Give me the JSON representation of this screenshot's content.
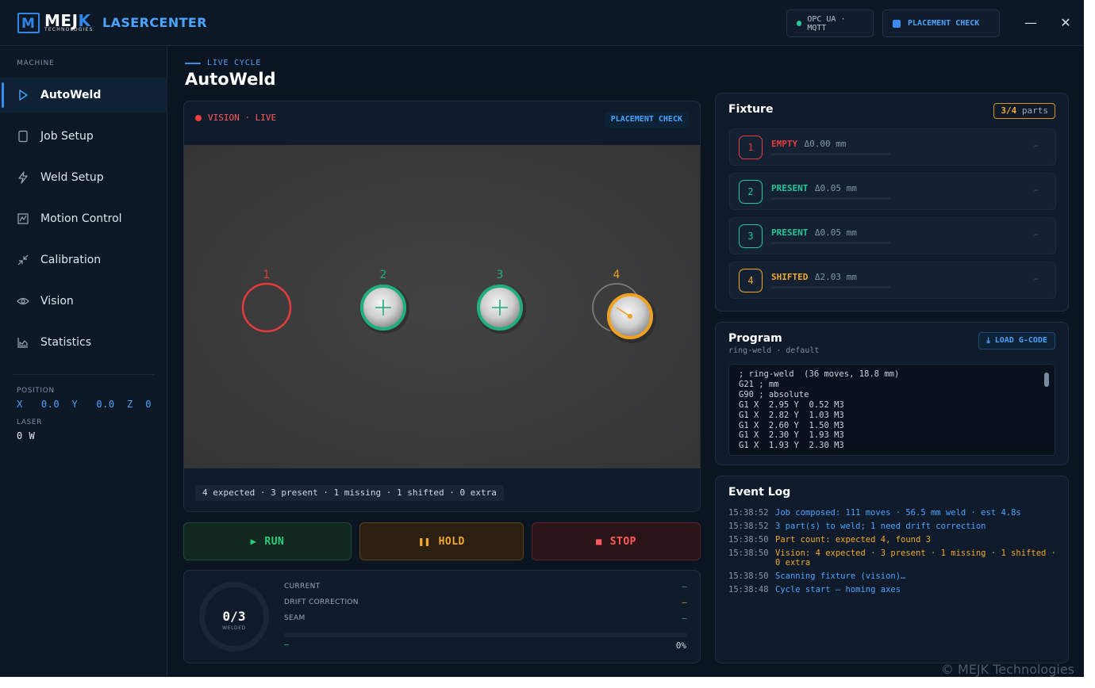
{
  "brand": {
    "mark": "M",
    "name_left": "MEJ",
    "name_right": "K",
    "sub": "TECHNOLOGIES",
    "app_title": "LASERCENTER"
  },
  "header": {
    "opc_label": "OPC UA · MQTT",
    "placement_label": "PLACEMENT CHECK",
    "minimize": "—",
    "close": "✕"
  },
  "sidebar": {
    "group": "MACHINE",
    "items": [
      {
        "label": "AutoWeld",
        "icon": "play-icon",
        "active": true
      },
      {
        "label": "Job Setup",
        "icon": "document-icon"
      },
      {
        "label": "Weld Setup",
        "icon": "lightning-icon"
      },
      {
        "label": "Motion Control",
        "icon": "chart-box-icon"
      },
      {
        "label": "Calibration",
        "icon": "crosshair-arrows-icon"
      },
      {
        "label": "Vision",
        "icon": "eye-icon"
      },
      {
        "label": "Statistics",
        "icon": "stats-icon"
      }
    ],
    "position_label": "POSITION",
    "position_value": "X   0.0  Y   0.0  Z  0",
    "laser_label": "LASER",
    "laser_value": "0 W"
  },
  "main": {
    "live_tag": "LIVE CYCLE",
    "title": "AutoWeld"
  },
  "vision": {
    "live_label": "VISION · LIVE",
    "badge": "PLACEMENT CHECK",
    "summary": "4 expected · 3 present · 1 missing · 1 shifted · 0 extra",
    "slots": [
      {
        "num": "1",
        "state": "empty",
        "color": "#e63b3b"
      },
      {
        "num": "2",
        "state": "present",
        "color": "#1fae7d"
      },
      {
        "num": "3",
        "state": "present",
        "color": "#1fae7d"
      },
      {
        "num": "4",
        "state": "shifted",
        "color": "#f0a020"
      }
    ]
  },
  "controls": {
    "run": "RUN",
    "hold": "HOLD",
    "stop": "STOP",
    "run_glyph": "▶",
    "hold_glyph": "❚❚",
    "stop_glyph": "■"
  },
  "progress": {
    "count": "0/3",
    "count_label": "WELDED",
    "rows": [
      {
        "label": "CURRENT",
        "value": "—",
        "color": "#4aa3ff"
      },
      {
        "label": "DRIFT CORRECTION",
        "value": "—",
        "color": "#f0a92a"
      },
      {
        "label": "SEAM",
        "value": "—",
        "color": "#4aa3ff"
      }
    ],
    "fraction": 0,
    "left_text": "—",
    "percent_text": "0%"
  },
  "fixture": {
    "title": "Fixture",
    "count": "3/4",
    "count_suffix": " parts",
    "rows": [
      {
        "num": "1",
        "status": "EMPTY",
        "delta": "Δ0.00 mm",
        "color": "#e63b3b",
        "dash": "–"
      },
      {
        "num": "2",
        "status": "PRESENT",
        "delta": "Δ0.05 mm",
        "color": "#20c997",
        "dash": "–"
      },
      {
        "num": "3",
        "status": "PRESENT",
        "delta": "Δ0.05 mm",
        "color": "#20c997",
        "dash": "–"
      },
      {
        "num": "4",
        "status": "SHIFTED",
        "delta": "Δ2.03 mm",
        "color": "#f0a92a",
        "dash": "–"
      }
    ]
  },
  "program": {
    "title": "Program",
    "subtitle": "ring-weld · default",
    "load_label": "⤓ LOAD G-CODE",
    "code": [
      "; ring-weld  (36 moves, 18.8 mm)",
      "G21 ; mm",
      "G90 ; absolute",
      "G1 X  2.95 Y  0.52 M3",
      "G1 X  2.82 Y  1.03 M3",
      "G1 X  2.60 Y  1.50 M3",
      "G1 X  2.30 Y  1.93 M3",
      "G1 X  1.93 Y  2.30 M3"
    ]
  },
  "log": {
    "title": "Event Log",
    "entries": [
      {
        "time": "15:38:52",
        "msg": "Job composed: 111 moves · 56.5 mm weld · est 4.8s",
        "level": "info"
      },
      {
        "time": "15:38:52",
        "msg": "3 part(s) to weld; 1 need drift correction",
        "level": "info"
      },
      {
        "time": "15:38:50",
        "msg": "Part count: expected 4, found 3",
        "level": "warn"
      },
      {
        "time": "15:38:50",
        "msg": "Vision: 4 expected · 3 present · 1 missing · 1 shifted · 0 extra",
        "level": "warn"
      },
      {
        "time": "15:38:50",
        "msg": "Scanning fixture (vision)…",
        "level": "info"
      },
      {
        "time": "15:38:48",
        "msg": "Cycle start — homing axes",
        "level": "info"
      }
    ]
  },
  "footer": {
    "copyright": "© MEJK Technologies"
  }
}
